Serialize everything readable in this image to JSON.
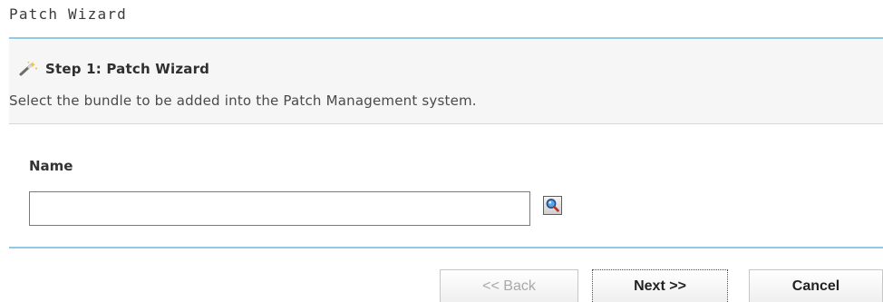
{
  "window": {
    "title": "Patch Wizard"
  },
  "step": {
    "icon": "magic-wand-icon",
    "title": "Step 1: Patch Wizard",
    "description": "Select the bundle to be added into the Patch Management system."
  },
  "form": {
    "name_label": "Name",
    "name_value": "",
    "name_placeholder": "",
    "lookup_icon": "magnifier-icon"
  },
  "buttons": {
    "back_label": "<< Back",
    "back_enabled": false,
    "next_label": "Next >>",
    "cancel_label": "Cancel"
  },
  "colors": {
    "accent_rule": "#8ecae6",
    "header_background": "#f6f6f6",
    "disabled_text": "#a9a9a9"
  }
}
